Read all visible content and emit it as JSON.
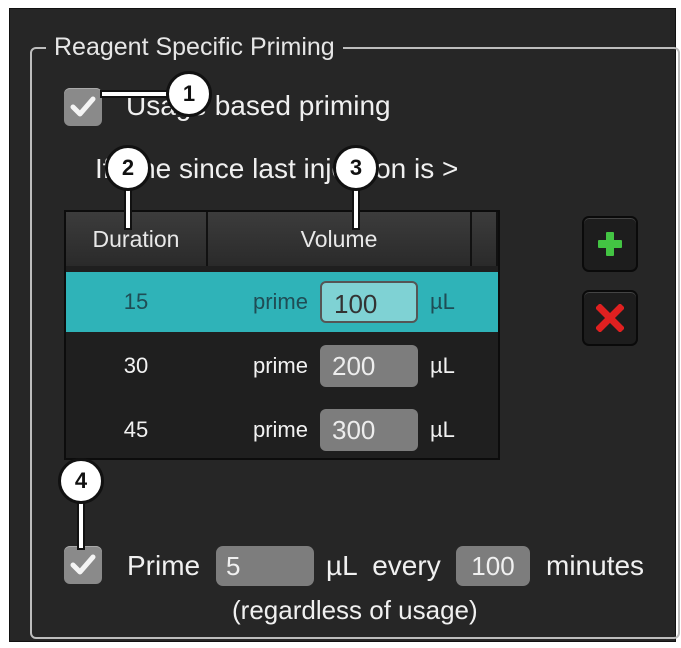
{
  "panel": {
    "legend": "Reagent Specific Priming",
    "usage_priming_label": "Usage based priming",
    "usage_priming_checked": true,
    "time_since_text": "If time since last injection is >",
    "table": {
      "columns": [
        "Duration",
        "Volume"
      ],
      "rows": [
        {
          "duration": "15",
          "prime": "prime",
          "volume": "100",
          "unit": "µL",
          "selected": true
        },
        {
          "duration": "30",
          "prime": "prime",
          "volume": "200",
          "unit": "µL",
          "selected": false
        },
        {
          "duration": "45",
          "prime": "prime",
          "volume": "300",
          "unit": "µL",
          "selected": false
        }
      ]
    },
    "add_icon": "plus-icon",
    "delete_icon": "x-icon",
    "periodic": {
      "checked": true,
      "prime_label": "Prime",
      "volume_value": "5",
      "unit_every": "µL  every",
      "minutes_value": "100",
      "minutes_label": "minutes",
      "note": "(regardless of usage)"
    }
  },
  "callouts": [
    "1",
    "2",
    "3",
    "4"
  ],
  "colors": {
    "panel_bg": "#262626",
    "selected_row": "#2fb3b8",
    "plus": "#43c443",
    "delete": "#e02020"
  }
}
